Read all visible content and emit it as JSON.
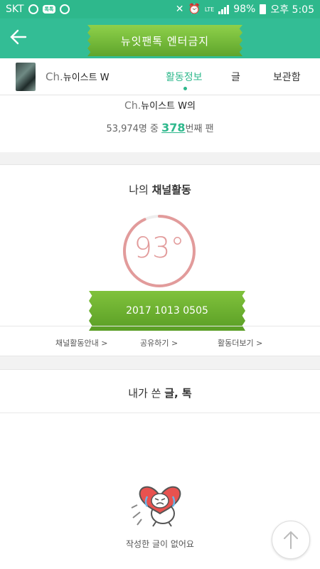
{
  "status_bar": {
    "carrier": "SKT",
    "carrier_pill": "톡톡",
    "network": "LTE",
    "battery": "98%",
    "time": "오후 5:05"
  },
  "header": {
    "back_icon": "arrow-left-icon",
    "title": "뉴잇팬톡 엔터금지"
  },
  "profile_tabs": {
    "channel_prefix": "Ch.",
    "channel_name": "뉴이스트 W",
    "tabs": [
      {
        "label": "활동정보",
        "active": true
      },
      {
        "label": "글",
        "active": false
      },
      {
        "label": "보관함",
        "active": false
      }
    ]
  },
  "rank": {
    "channel_prefix": "Ch.",
    "channel_name": "뉴이스트 W의",
    "total": "53,974명 중",
    "position": "378",
    "suffix": "번째 팬"
  },
  "activity": {
    "title_prefix": "나의",
    "title_bold": "채널활동",
    "score": "93°",
    "score_fraction": 0.93,
    "date": "2017 1013 0505",
    "links": [
      "채널활동안내 >",
      "공유하기 >",
      "활동더보기 >"
    ]
  },
  "posts": {
    "title_prefix": "내가 쓴",
    "title_bold": "글, 톡",
    "empty_message": "작성한 글이 없어요",
    "scroll_top_icon": "arrow-up-icon"
  },
  "colors": {
    "accent": "#2eb88c",
    "ribbon": "#6fb232",
    "gauge": "#e29b9b"
  }
}
